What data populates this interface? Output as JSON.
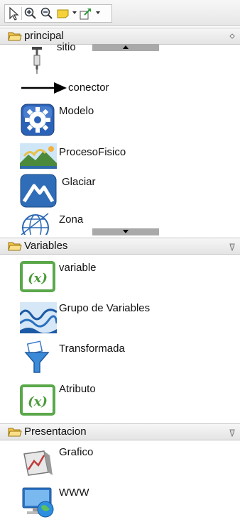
{
  "toolbar": {
    "icons": [
      "select-pointer-icon",
      "zoom-in-icon",
      "zoom-out-icon",
      "note-icon",
      "export-icon"
    ]
  },
  "sections": {
    "principal": {
      "title": "principal",
      "items": [
        {
          "label": "sitio",
          "icon": "sitio-icon"
        },
        {
          "label": "conector",
          "icon": "conector-arrow-icon"
        },
        {
          "label": "Modelo",
          "icon": "gear-icon"
        },
        {
          "label": "ProcesoFisico",
          "icon": "landscape-icon"
        },
        {
          "label": "Glaciar",
          "icon": "mountain-icon"
        },
        {
          "label": "Zona",
          "icon": "globe-grid-icon"
        }
      ]
    },
    "variables": {
      "title": "Variables",
      "items": [
        {
          "label": "variable",
          "icon": "variable-x-icon"
        },
        {
          "label": "Grupo de Variables",
          "icon": "variable-group-icon"
        },
        {
          "label": "Transformada",
          "icon": "funnel-icon"
        },
        {
          "label": "Atributo",
          "icon": "attribute-x-icon"
        }
      ]
    },
    "presentacion": {
      "title": "Presentacion",
      "items": [
        {
          "label": "Grafico",
          "icon": "chart-box-icon"
        },
        {
          "label": "WWW",
          "icon": "computer-globe-icon"
        }
      ]
    }
  },
  "colors": {
    "variable_green": "#5aa84a",
    "gear_blue": "#2b63b8",
    "glaciar_blue": "#2f6db8"
  }
}
